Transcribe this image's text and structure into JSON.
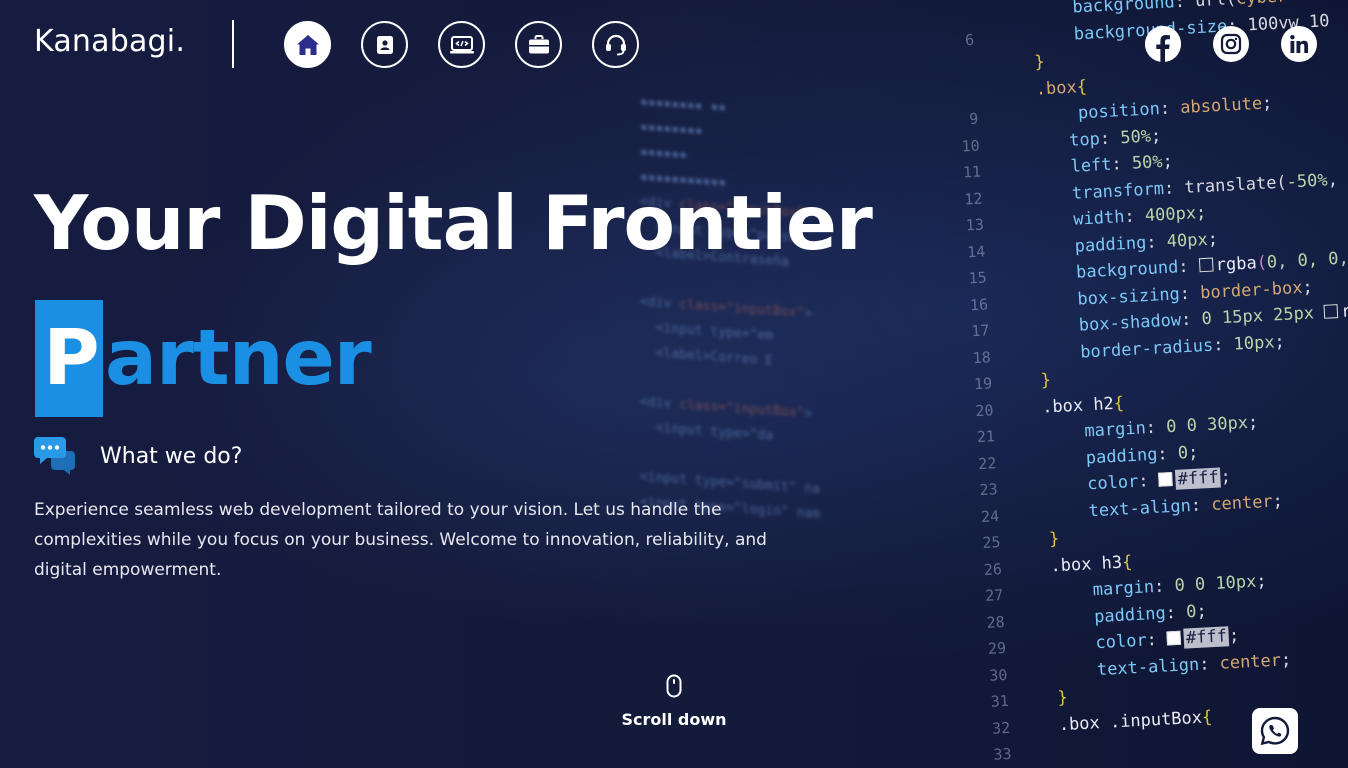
{
  "header": {
    "logo": "Kanabagi.",
    "nav": [
      {
        "name": "home",
        "icon": "home-icon",
        "active": true
      },
      {
        "name": "contact",
        "icon": "contact-book-icon",
        "active": false
      },
      {
        "name": "projects",
        "icon": "laptop-code-icon",
        "active": false
      },
      {
        "name": "services",
        "icon": "briefcase-icon",
        "active": false
      },
      {
        "name": "support",
        "icon": "headset-icon",
        "active": false
      }
    ],
    "social": [
      "facebook-icon",
      "instagram-icon",
      "linkedin-icon"
    ]
  },
  "hero": {
    "headline": "Your Digital Frontier",
    "partner_first": "P",
    "partner_rest": "artner",
    "what_we_do": "What we do?",
    "description": "Experience seamless web development tailored to your vision. Let us handle the complexities while you focus on your business. Welcome to innovation, reliability, and digital empowerment.",
    "scroll_label": "Scroll down"
  },
  "colors": {
    "background": "#141a3a",
    "accent": "#1a8fe3",
    "text": "#ffffff"
  }
}
